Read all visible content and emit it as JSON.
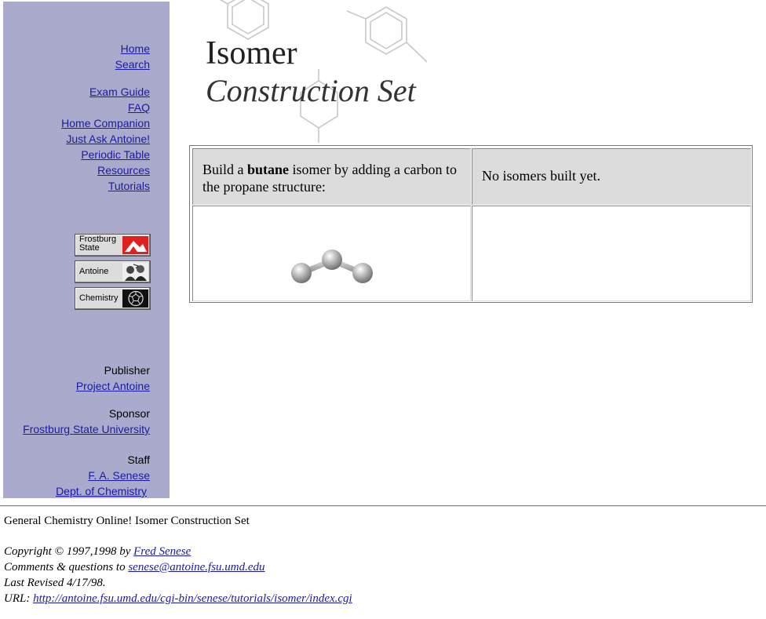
{
  "sidebar": {
    "nav_top": [
      "Home",
      "Search"
    ],
    "nav_main": [
      "Exam Guide",
      "FAQ",
      "Home Companion",
      "Just Ask Antoine!",
      "Periodic Table",
      "Resources",
      "Tutorials"
    ],
    "badges": {
      "frostburg_line1": "Frostburg",
      "frostburg_line2": "State",
      "antoine": "Antoine",
      "chemistry": "Chemistry"
    },
    "publisher_label": "Publisher",
    "publisher_link": "Project Antoine",
    "sponsor_label": "Sponsor",
    "sponsor_link": "Frostburg State University",
    "staff_label": "Staff",
    "staff_links": [
      "F. A. Senese",
      "Dept. of Chemistry"
    ]
  },
  "logo": {
    "line1": "Isomer",
    "line2": "Construction Set"
  },
  "table": {
    "instruction_pre": "Build a ",
    "instruction_bold": "butane",
    "instruction_post": " isomer by adding a carbon to the propane structure:",
    "status": "No isomers built yet."
  },
  "footer": {
    "title": "General Chemistry Online! Isomer Construction Set",
    "copyright_text": "Copyright © 1997,1998 by ",
    "copyright_link": "Fred Senese",
    "comments_text": "Comments & questions to ",
    "comments_link": "senese@antoine.fsu.umd.edu",
    "revised": "Last Revised 4/17/98.",
    "url_label": "URL: ",
    "url_link": "http://antoine.fsu.umd.edu/cgi-bin/senese/tutorials/isomer/index.cgi"
  },
  "colors": {
    "sidebar_bg": "#aaaacc",
    "link": "#1a1aa6",
    "header_cell_bg": "#dcdcdc"
  }
}
